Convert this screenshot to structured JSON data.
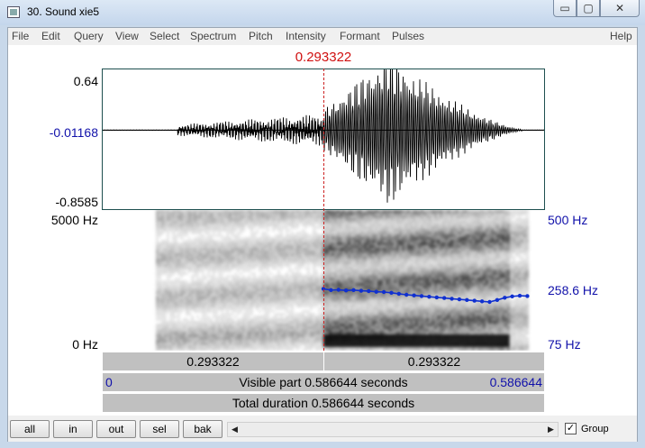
{
  "window": {
    "title": "30. Sound xie5",
    "minimize_glyph": "▭",
    "maximize_glyph": "▢",
    "close_glyph": "✕"
  },
  "menu": {
    "items": [
      "File",
      "Edit",
      "Query",
      "View",
      "Select",
      "Spectrum",
      "Pitch",
      "Intensity",
      "Formant",
      "Pulses"
    ],
    "help": "Help"
  },
  "cursor": {
    "time_label": "0.293322",
    "time": 0.293322,
    "color": "#d01010"
  },
  "waveform": {
    "y_max_label": "0.64",
    "y_mid_label": "-0.01168",
    "y_min_label": "-0.8585",
    "y_max": 0.64,
    "y_min": -0.8585,
    "baseline": -0.01168
  },
  "spectrogram": {
    "freq_max_label": "5000 Hz",
    "freq_min_label": "0 Hz",
    "pitch_max_label": "500 Hz",
    "pitch_mid_label": "258.6 Hz",
    "pitch_min_label": "75 Hz",
    "pitch_color": "#1030d0"
  },
  "chart_data": {
    "type": "line",
    "title": "",
    "xlabel": "",
    "ylabel": "",
    "xlim": [
      0,
      0.586644
    ],
    "ylim": [
      75,
      500
    ],
    "series": [
      {
        "x": [
          0.2933,
          0.3033,
          0.3133,
          0.3233,
          0.3333,
          0.3433,
          0.3533,
          0.3633,
          0.3733,
          0.3833,
          0.3933,
          0.4033,
          0.4133,
          0.4233,
          0.4333,
          0.4433,
          0.4533,
          0.4633,
          0.4733,
          0.4833,
          0.4933,
          0.5033,
          0.5133,
          0.5233,
          0.5333,
          0.5433,
          0.5533,
          0.5633
        ],
        "values": [
          262,
          258,
          259,
          257,
          258,
          256,
          255,
          253,
          252,
          250,
          247,
          244,
          242,
          240,
          238,
          236,
          234,
          232,
          230,
          228,
          226,
          224,
          222,
          228,
          235,
          239,
          241,
          240
        ]
      }
    ]
  },
  "bars": {
    "left_time": "0.293322",
    "right_time": "0.293322",
    "visible_start": "0",
    "visible_text": "Visible part 0.586644 seconds",
    "visible_end": "0.586644",
    "total_text": "Total duration 0.586644 seconds"
  },
  "toolbar": {
    "buttons": [
      "all",
      "in",
      "out",
      "sel",
      "bak"
    ],
    "group_label": "Group",
    "group_checked": "✓"
  }
}
